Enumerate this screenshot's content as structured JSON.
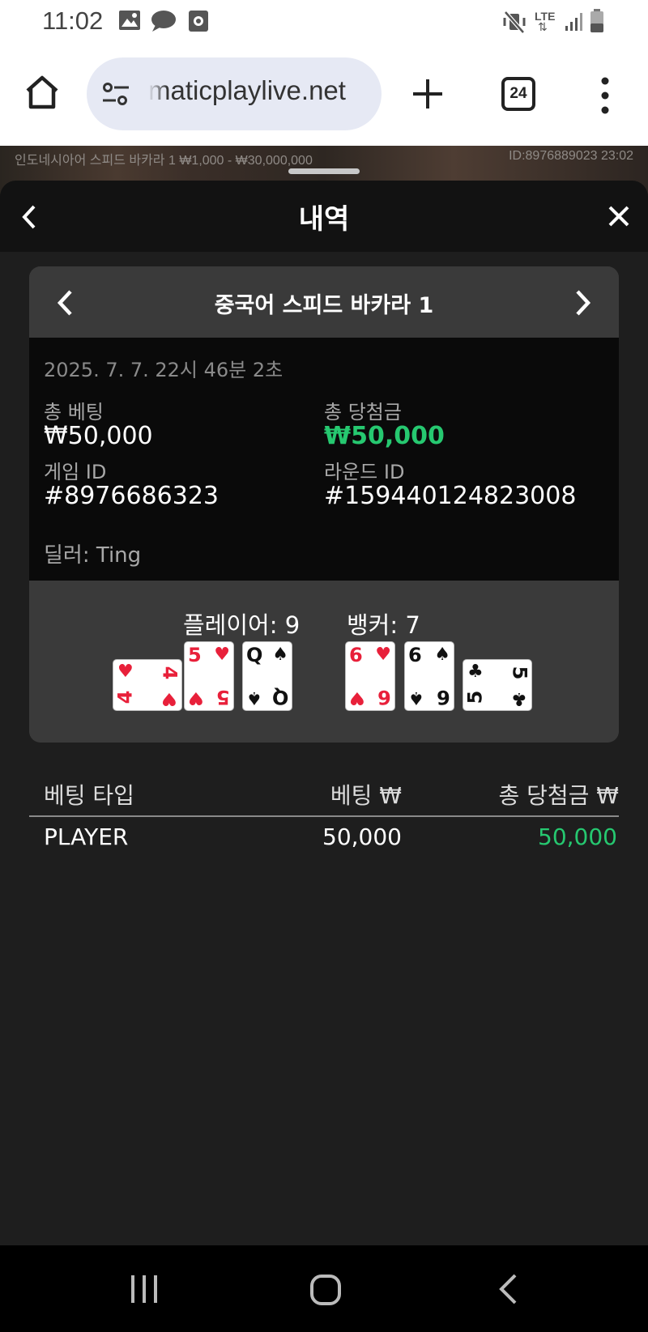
{
  "status_bar": {
    "time": "11:02",
    "left_icons": [
      "image-icon",
      "chat-bubble-icon",
      "screen-record-icon"
    ],
    "right_icons": [
      "mute-vibrate-icon",
      "lte-icon",
      "signal-icon",
      "battery-icon"
    ],
    "network": "LTE"
  },
  "browser": {
    "url": "maticplaylive.net",
    "tab_count": "24"
  },
  "game_strip": {
    "table_info": "인도네시아어 스피드 바카라 1 ₩1,000 - ₩30,000,000",
    "game_info": "ID:8976889023 23:02"
  },
  "sheet": {
    "title": "내역"
  },
  "round": {
    "title": "중국어 스피드 바카라 1",
    "datetime": "2025. 7. 7. 22시 46분 2초",
    "total_bet_label": "총 베팅",
    "total_bet": "₩50,000",
    "total_win_label": "총 당첨금",
    "total_win": "₩50,000",
    "game_id_label": "게임 ID",
    "game_id": "#8976686323",
    "round_id_label": "라운드 ID",
    "round_id": "#159440124823008",
    "dealer": "딜러: Ting",
    "player_score": "플레이어: 9",
    "banker_score": "뱅커: 7",
    "player_cards": [
      {
        "rank": "4",
        "suit": "♥",
        "color": "red",
        "orientation": "sideways"
      },
      {
        "rank": "5",
        "suit": "♥",
        "color": "red",
        "orientation": "upright"
      },
      {
        "rank": "Q",
        "suit": "♠",
        "color": "black",
        "orientation": "upright"
      }
    ],
    "banker_cards": [
      {
        "rank": "6",
        "suit": "♥",
        "color": "red",
        "orientation": "upright"
      },
      {
        "rank": "6",
        "suit": "♠",
        "color": "black",
        "orientation": "upright"
      },
      {
        "rank": "5",
        "suit": "♣",
        "color": "black",
        "orientation": "sideways"
      }
    ]
  },
  "bets_table": {
    "headers": [
      "베팅 타입",
      "베팅 ₩",
      "총 당첨금 ₩"
    ],
    "rows": [
      {
        "type": "PLAYER",
        "bet": "50,000",
        "win": "50,000"
      }
    ]
  },
  "colors": {
    "win_green": "#26c870",
    "card_red": "#e8203a"
  }
}
